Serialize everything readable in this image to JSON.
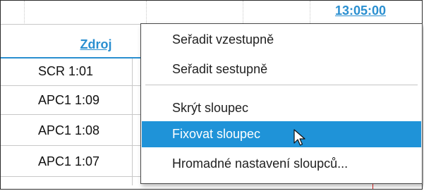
{
  "grid": {
    "time_header": "13:05:00",
    "column_header": "Zdroj",
    "rows": [
      "SCR 1:01",
      "APC1 1:09",
      "APC1 1:08",
      "APC1 1:07"
    ]
  },
  "context_menu": {
    "items": [
      {
        "label": "Seřadit vzestupně",
        "selected": false
      },
      {
        "label": "Seřadit sestupně",
        "selected": false
      },
      {
        "label": "Skrýt sloupec",
        "selected": false
      },
      {
        "label": "Fixovat sloupec",
        "selected": true
      },
      {
        "label": "Hromadné nastavení sloupců...",
        "selected": false
      }
    ]
  },
  "colors": {
    "accent": "#2a8fd0",
    "selection": "#1f93d8",
    "marker": "#e02020"
  },
  "icons": {
    "cursor": "arrow-cursor-icon"
  }
}
